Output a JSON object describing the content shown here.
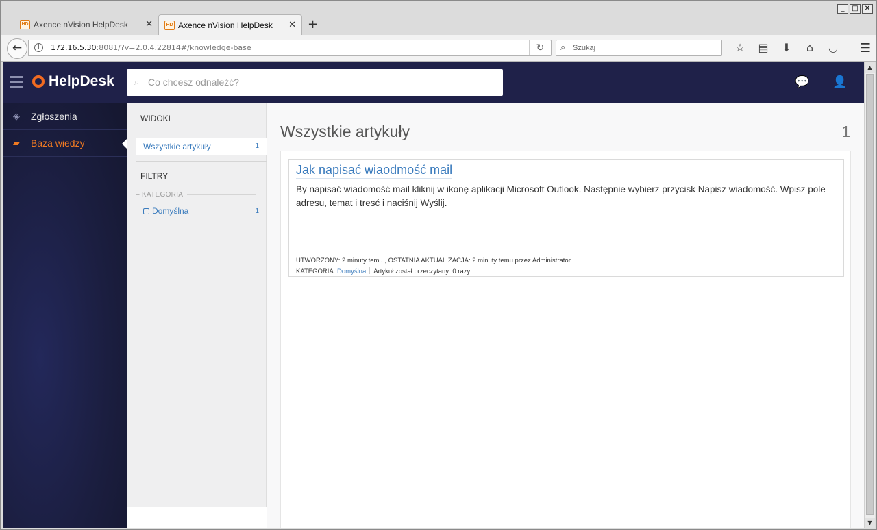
{
  "window": {
    "controls": [
      "_",
      "□",
      "✕"
    ]
  },
  "tabs": [
    {
      "title": "Axence nVision HelpDesk",
      "favicon": "HD",
      "active": false
    },
    {
      "title": "Axence nVision HelpDesk",
      "favicon": "HD",
      "active": true
    }
  ],
  "browser": {
    "url_host": "172.16.5.30",
    "url_rest": ":8081/?v=2.0.4.22814#/knowledge-base",
    "search_placeholder": "Szukaj",
    "icons": [
      "back-arrow-icon",
      "info-icon",
      "reload-icon",
      "search-icon",
      "bookmark-star-icon",
      "reading-list-icon",
      "download-icon",
      "home-icon",
      "pocket-icon",
      "hamburger-menu-icon"
    ]
  },
  "app": {
    "brand": "HelpDesk",
    "brand_color": "#f26b21",
    "header_color": "#1f2149",
    "search_placeholder": "Co chcesz odnaleźć?",
    "nav": [
      {
        "label": "Zgłoszenia",
        "icon": "ticket-icon",
        "active": false
      },
      {
        "label": "Baza wiedzy",
        "icon": "book-icon",
        "active": true
      }
    ]
  },
  "views": {
    "title": "WIDOKI",
    "items": [
      {
        "label": "Wszystkie artykuły",
        "count": "1"
      }
    ],
    "filters_title": "FILTRY",
    "category_label": "KATEGORIA",
    "filters": [
      {
        "label": "Domyślna",
        "count": "1"
      }
    ]
  },
  "content": {
    "title": "Wszystkie artykuły",
    "count": "1",
    "articles": [
      {
        "title": "Jak napisać wiaodmość mail",
        "body": "By napisać wiadomość mail kliknij w ikonę aplikacji Microsoft Outlook. Następnie wybierz przycisk Napisz wiadomość. Wpisz pole adresu, temat i tresć i naciśnij Wyślij.",
        "meta_created": "UTWORZONY: 2 minuty temu , OSTATNIA AKTUALIZACJA: 2 minuty temu przez Administrator",
        "category_prefix": "KATEGORIA:",
        "category": "Domyślna",
        "read_count": "Artykuł został przeczytany: 0 razy"
      }
    ]
  }
}
